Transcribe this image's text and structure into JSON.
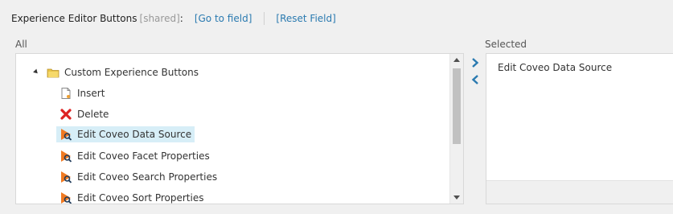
{
  "header": {
    "field_label": "Experience Editor Buttons",
    "shared_tag": "[shared]",
    "colon": ":",
    "goto_link": "[Go to field]",
    "reset_link": "[Reset Field]"
  },
  "columns": {
    "all_label": "All",
    "selected_label": "Selected"
  },
  "tree": {
    "root_label": "Custom Experience Buttons",
    "items": [
      {
        "label": "Insert",
        "icon": "document-icon"
      },
      {
        "label": "Delete",
        "icon": "delete-icon"
      },
      {
        "label": "Edit Coveo Data Source",
        "icon": "coveo-edit-icon"
      },
      {
        "label": "Edit Coveo Facet Properties",
        "icon": "coveo-edit-icon"
      },
      {
        "label": "Edit Coveo Search Properties",
        "icon": "coveo-edit-icon"
      },
      {
        "label": "Edit Coveo Sort Properties",
        "icon": "coveo-edit-icon"
      }
    ]
  },
  "selected": {
    "items": [
      "Edit Coveo Data Source"
    ]
  },
  "colors": {
    "link": "#2a7ab0",
    "highlight": "#d7eef7",
    "arrow": "#2a7ab0"
  }
}
